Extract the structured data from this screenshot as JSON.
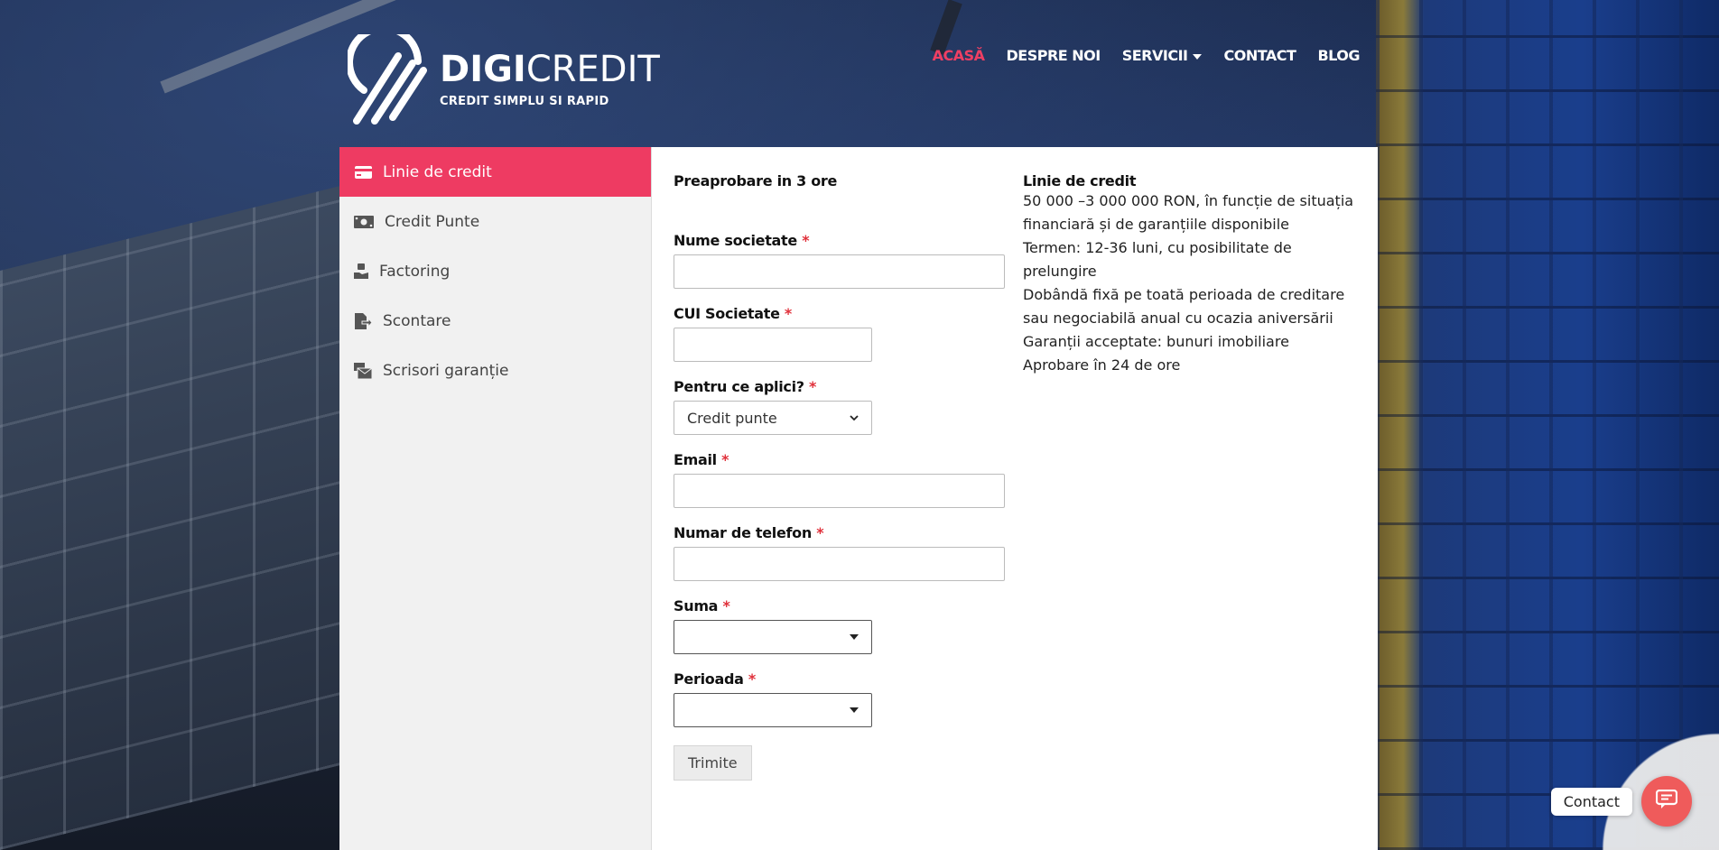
{
  "brand": {
    "name_bold": "DIGI",
    "name_light": "CREDIT",
    "tagline": "CREDIT SIMPLU SI RAPID"
  },
  "nav": {
    "items": [
      {
        "label": "ACASĂ",
        "active": true
      },
      {
        "label": "DESPRE NOI"
      },
      {
        "label": "SERVICII",
        "has_dropdown": true
      },
      {
        "label": "CONTACT"
      },
      {
        "label": "BLOG"
      }
    ]
  },
  "sidebar": {
    "items": [
      {
        "label": "Linie de credit",
        "icon": "credit-card-icon",
        "active": true
      },
      {
        "label": "Credit Punte",
        "icon": "money-bill-icon"
      },
      {
        "label": "Factoring",
        "icon": "hand-holding-icon"
      },
      {
        "label": "Scontare",
        "icon": "file-export-icon"
      },
      {
        "label": "Scrisori garanție",
        "icon": "mail-bulk-icon"
      }
    ]
  },
  "form": {
    "heading": "Preaprobare in 3 ore",
    "required_mark": "*",
    "fields": {
      "company_name": {
        "label": "Nume societate",
        "value": ""
      },
      "cui": {
        "label": "CUI Societate",
        "value": ""
      },
      "apply_for": {
        "label": "Pentru ce aplici?",
        "selected": "Credit punte"
      },
      "email": {
        "label": "Email",
        "value": ""
      },
      "phone": {
        "label": "Numar de telefon",
        "value": ""
      },
      "amount": {
        "label": "Suma",
        "selected": ""
      },
      "period": {
        "label": "Perioada",
        "selected": ""
      }
    },
    "submit_label": "Trimite"
  },
  "info": {
    "title": "Linie de credit",
    "lines": [
      "50 000 –3 000 000 RON, în funcție de situația",
      "financiară și de garanțiile disponibile",
      "Termen: 12-36 luni, cu posibilitate de",
      "prelungire",
      "Dobândă fixă pe toată perioada de creditare",
      "sau negociabilă anual cu ocazia aniversării",
      "Garanții acceptate: bunuri imobiliare",
      "Aprobare în 24 de ore"
    ]
  },
  "contact_widget": {
    "label": "Contact",
    "icon": "chat-icon"
  },
  "colors": {
    "accent": "#ee3b62",
    "nav_active": "#ef3f63",
    "contact_button": "#ef5b5b",
    "required": "#e0303a"
  }
}
